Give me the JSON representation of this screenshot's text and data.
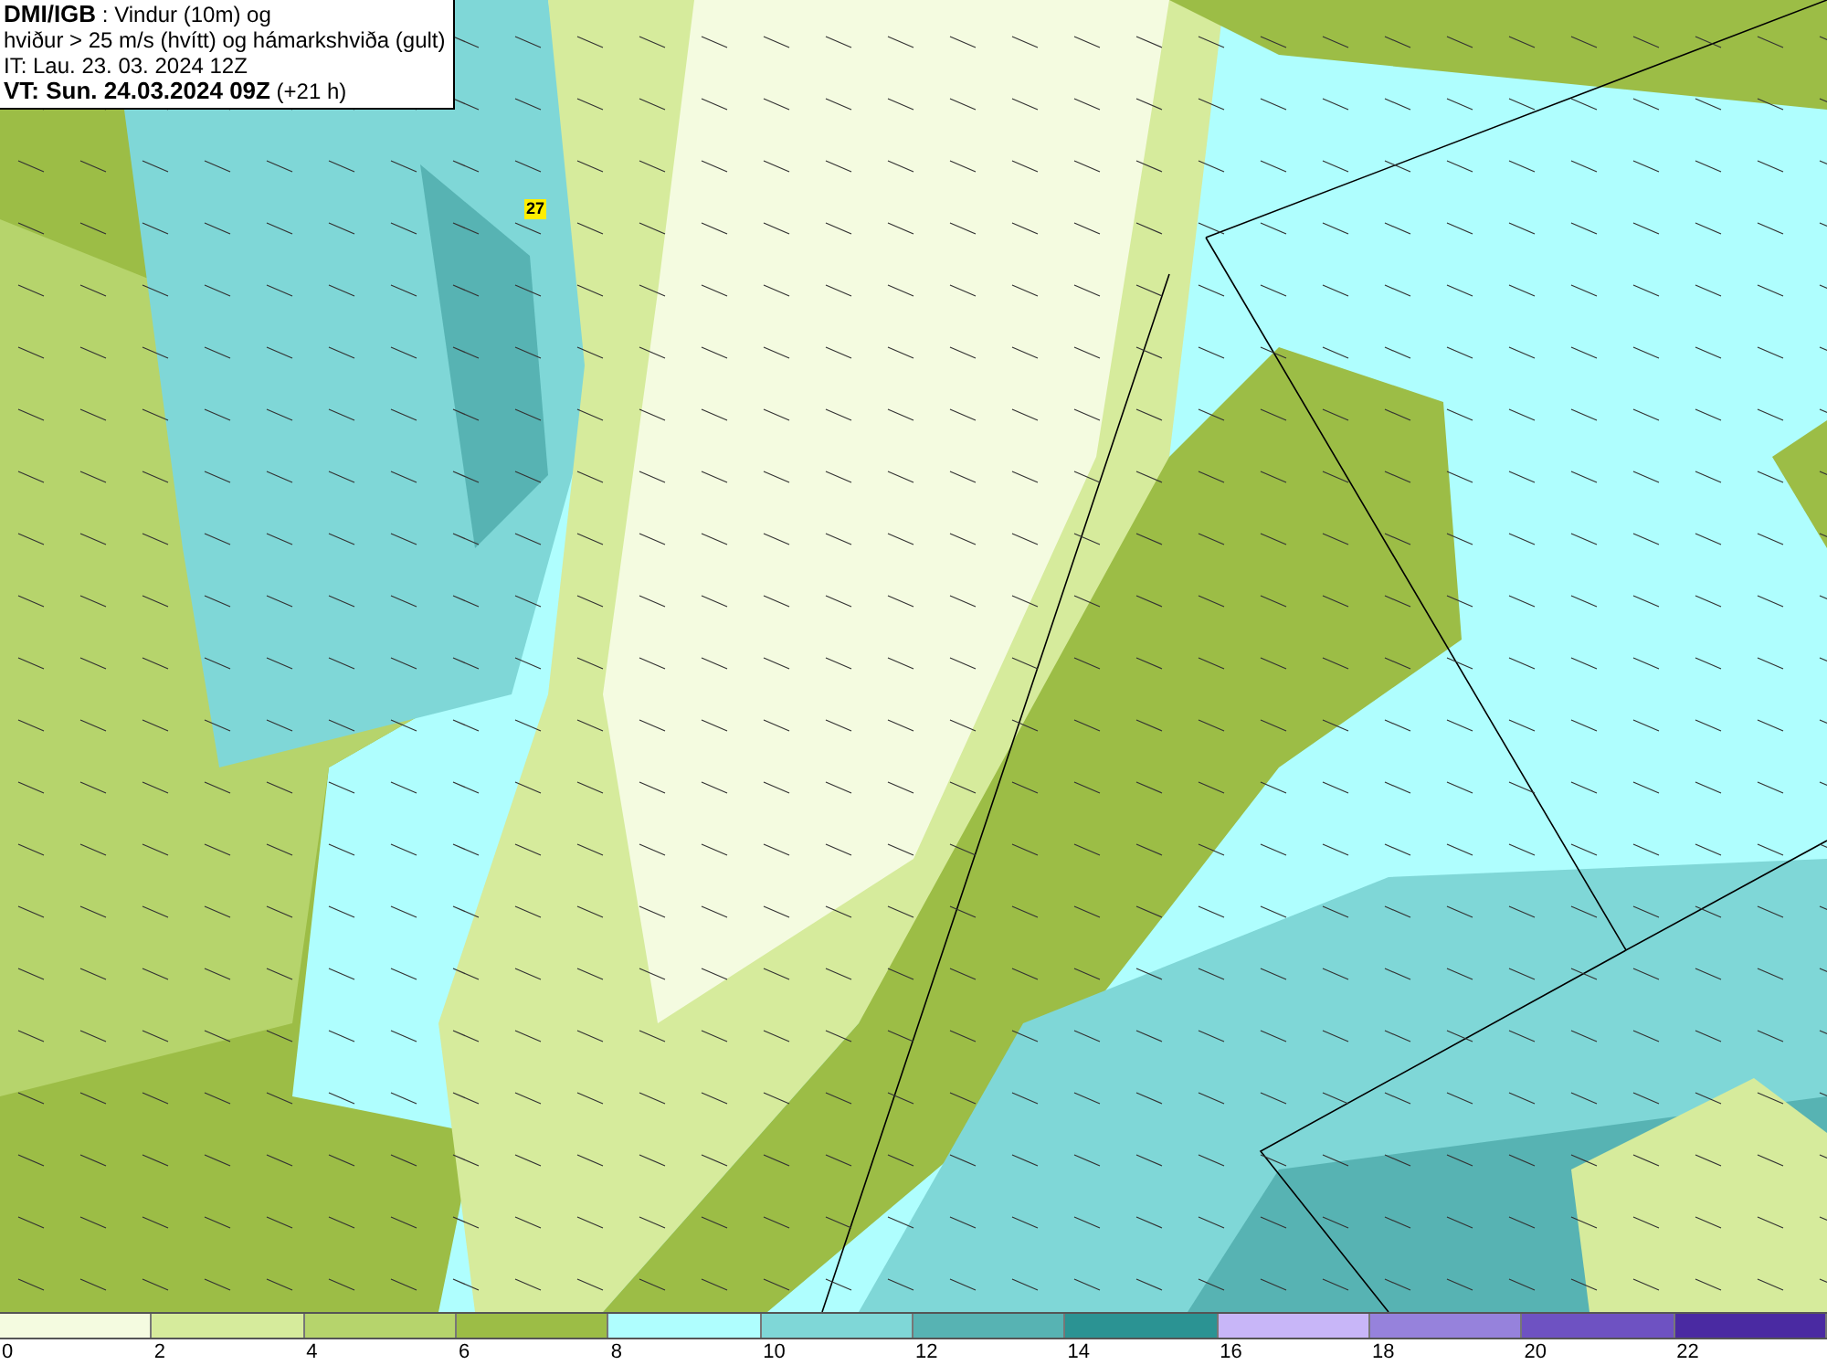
{
  "title_box": {
    "lines": [
      "**DMI/IGB** : Vindur (10m) og",
      "hviður > 25 m/s (hvítt) og hámarkshviða (gult)",
      "IT: Lau. 23. 03. 2024 12Z",
      "**VT: Sun. 24.03.2024 09Z** (+21 h)"
    ]
  },
  "map": {
    "gust_labels": [
      "27"
    ]
  },
  "legend": {
    "segments": [
      {
        "color": "#f4fbe0"
      },
      {
        "color": "#d6eb9c"
      },
      {
        "color": "#b6d46c"
      },
      {
        "color": "#9cbd46"
      },
      {
        "color": "#affefe"
      },
      {
        "color": "#7fd7d7"
      },
      {
        "color": "#57b3b3"
      },
      {
        "color": "#2b9393"
      },
      {
        "color": "#c8b6f8"
      },
      {
        "color": "#9682dc"
      },
      {
        "color": "#6e52c2"
      },
      {
        "color": "#4a2aa2"
      }
    ],
    "ticks": [
      "0",
      "2",
      "4",
      "6",
      "8",
      "10",
      "12",
      "14",
      "16",
      "18",
      "20",
      "22"
    ]
  }
}
